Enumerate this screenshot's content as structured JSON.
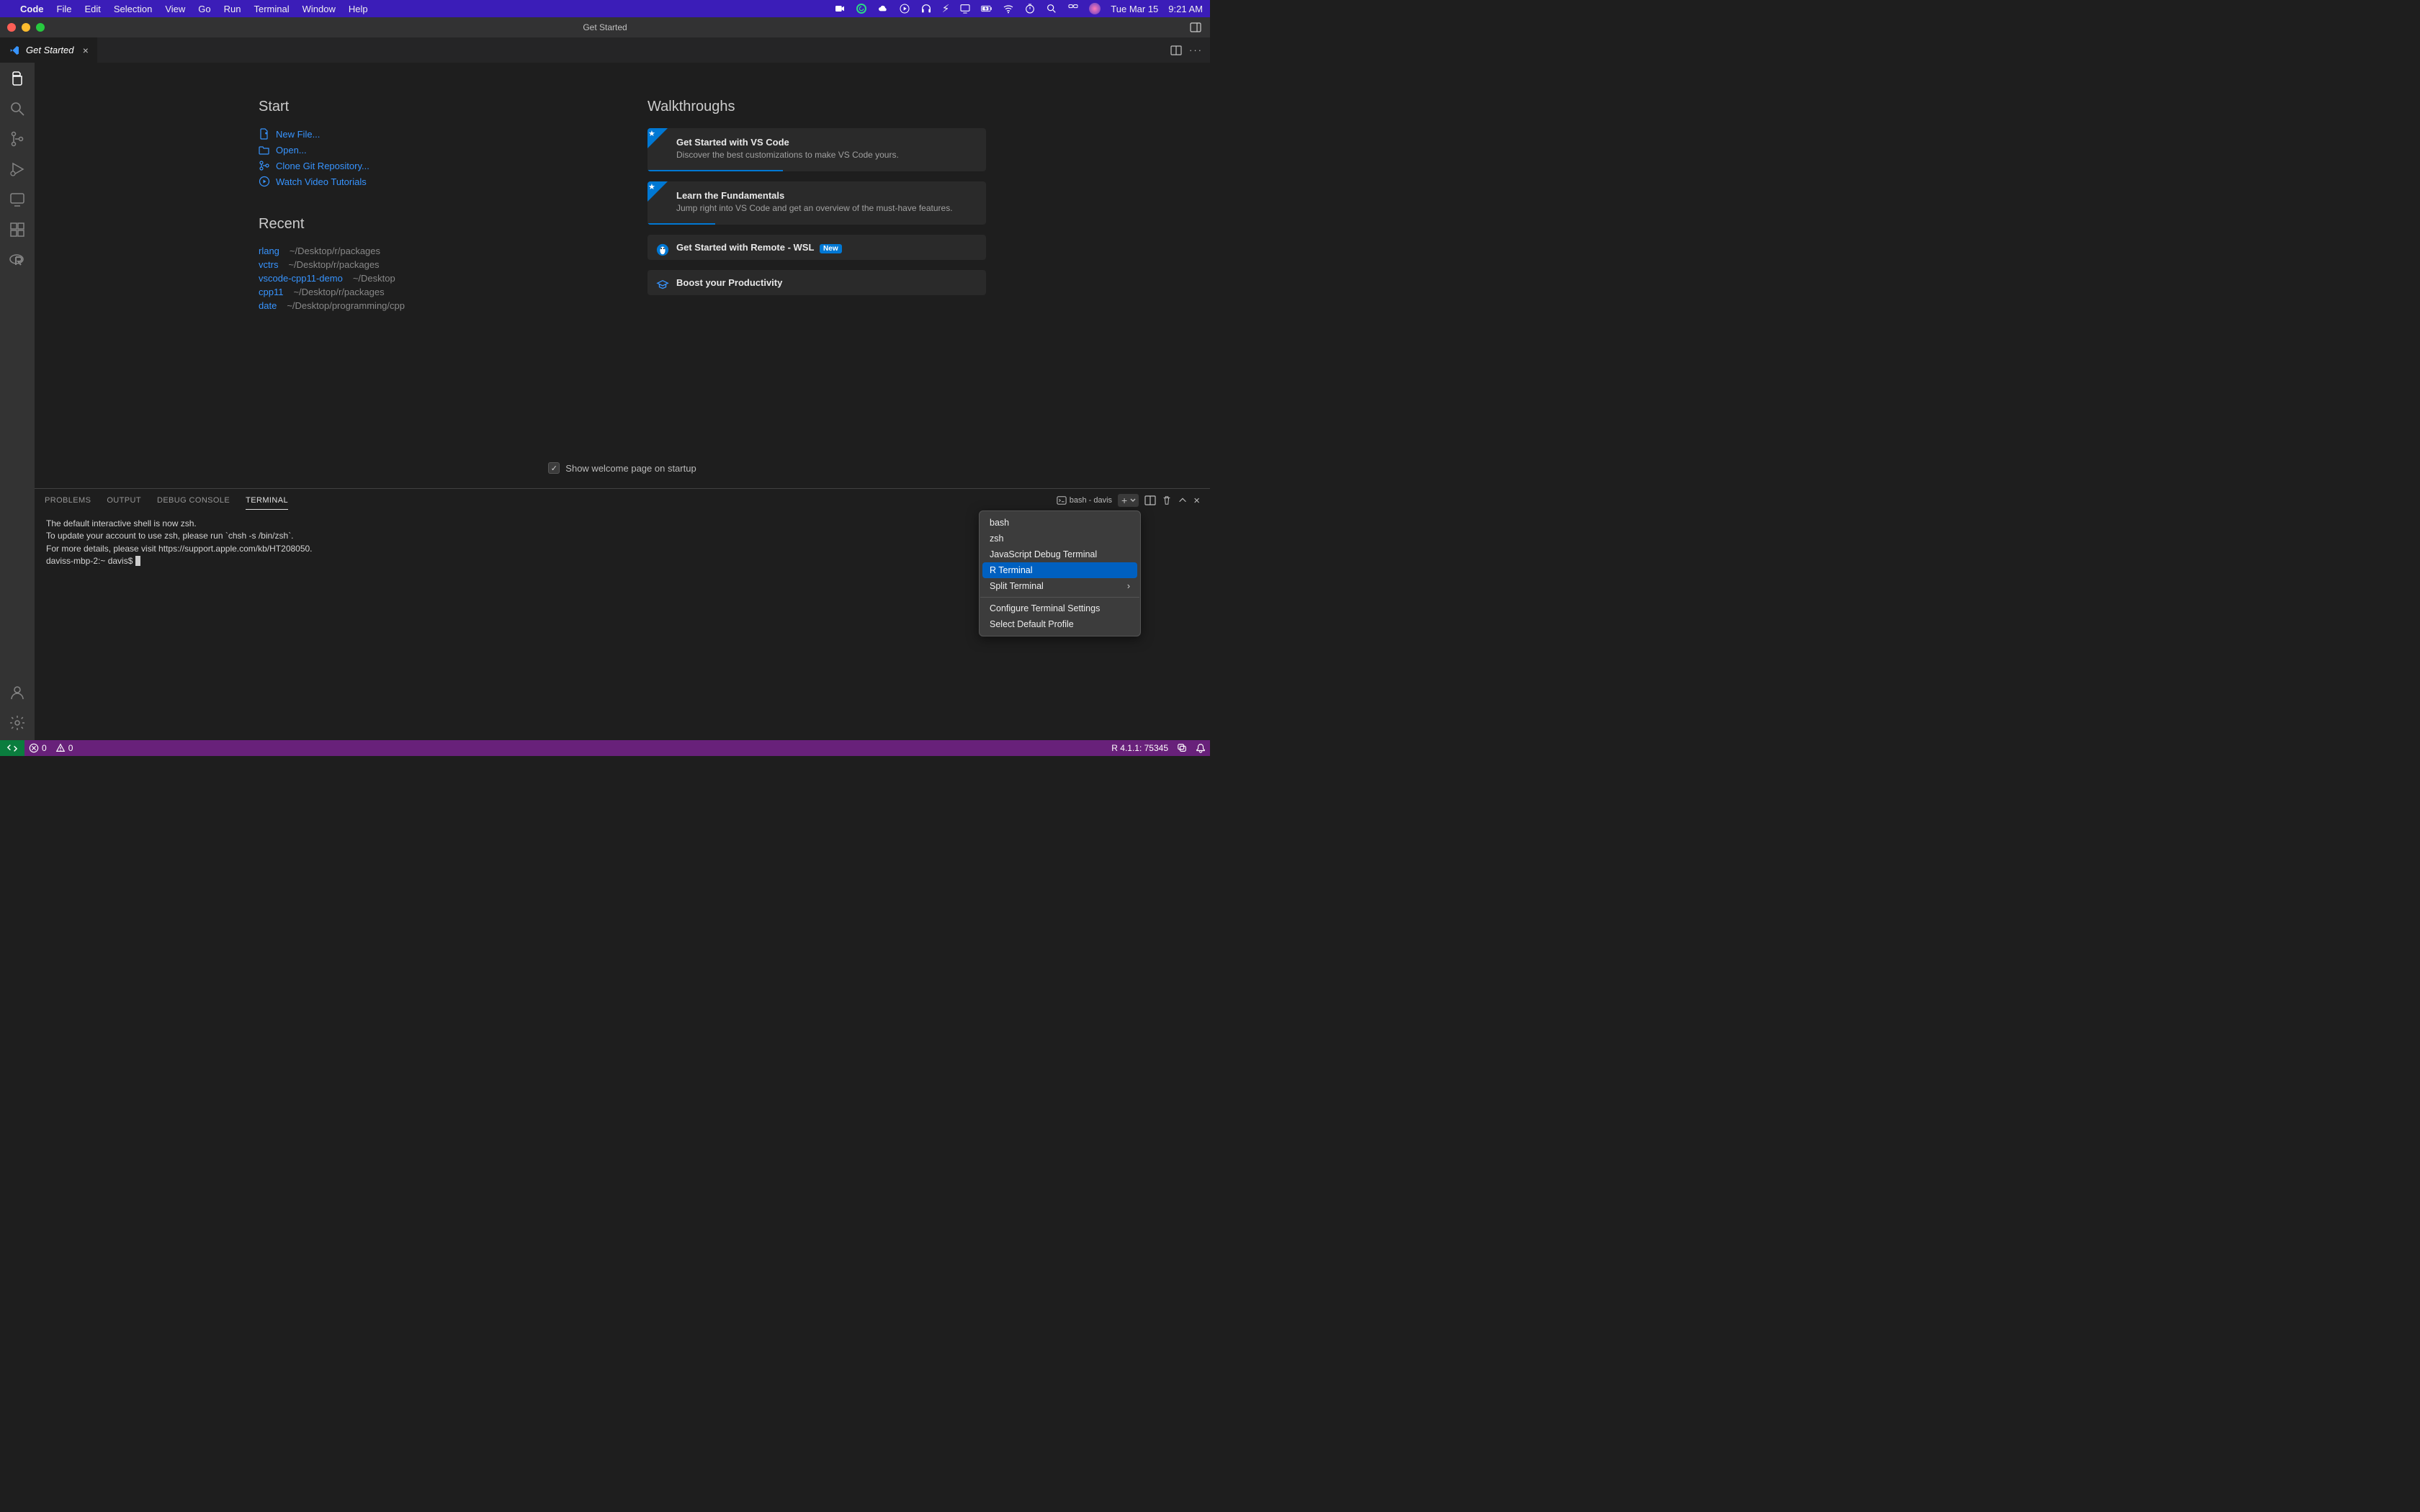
{
  "menubar": {
    "app_name": "Code",
    "items": [
      "File",
      "Edit",
      "Selection",
      "View",
      "Go",
      "Run",
      "Terminal",
      "Window",
      "Help"
    ],
    "date": "Tue Mar 15",
    "time": "9:21 AM"
  },
  "titlebar": {
    "title": "Get Started"
  },
  "tab": {
    "label": "Get Started"
  },
  "welcome": {
    "sections": {
      "start_title": "Start",
      "recent_title": "Recent",
      "walkthroughs_title": "Walkthroughs"
    },
    "start_items": {
      "new_file": "New File...",
      "open": "Open...",
      "clone": "Clone Git Repository...",
      "tutorials": "Watch Video Tutorials"
    },
    "recent": [
      {
        "name": "rlang",
        "path": "~/Desktop/r/packages"
      },
      {
        "name": "vctrs",
        "path": "~/Desktop/r/packages"
      },
      {
        "name": "vscode-cpp11-demo",
        "path": "~/Desktop"
      },
      {
        "name": "cpp11",
        "path": "~/Desktop/r/packages"
      },
      {
        "name": "date",
        "path": "~/Desktop/programming/cpp"
      }
    ],
    "walkthroughs": {
      "w1_title": "Get Started with VS Code",
      "w1_desc": "Discover the best customizations to make VS Code yours.",
      "w2_title": "Learn the Fundamentals",
      "w2_desc": "Jump right into VS Code and get an overview of the must-have features.",
      "w3_title": "Get Started with Remote - WSL",
      "w3_new": "New",
      "w4_title": "Boost your Productivity"
    },
    "startup_check": "Show welcome page on startup"
  },
  "panel": {
    "tabs": {
      "problems": "PROBLEMS",
      "output": "OUTPUT",
      "debug_console": "DEBUG CONSOLE",
      "terminal": "TERMINAL"
    },
    "shell_label": "bash - davis"
  },
  "terminal": {
    "text": "The default interactive shell is now zsh.\nTo update your account to use zsh, please run `chsh -s /bin/zsh`.\nFor more details, please visit https://support.apple.com/kb/HT208050.\ndaviss-mbp-2:~ davis$ "
  },
  "dropdown": {
    "bash": "bash",
    "zsh": "zsh",
    "js_debug": "JavaScript Debug Terminal",
    "r_terminal": "R Terminal",
    "split": "Split Terminal",
    "configure": "Configure Terminal Settings",
    "select_default": "Select Default Profile"
  },
  "statusbar": {
    "errors": "0",
    "warnings": "0",
    "r_status": "R 4.1.1: 75345"
  }
}
